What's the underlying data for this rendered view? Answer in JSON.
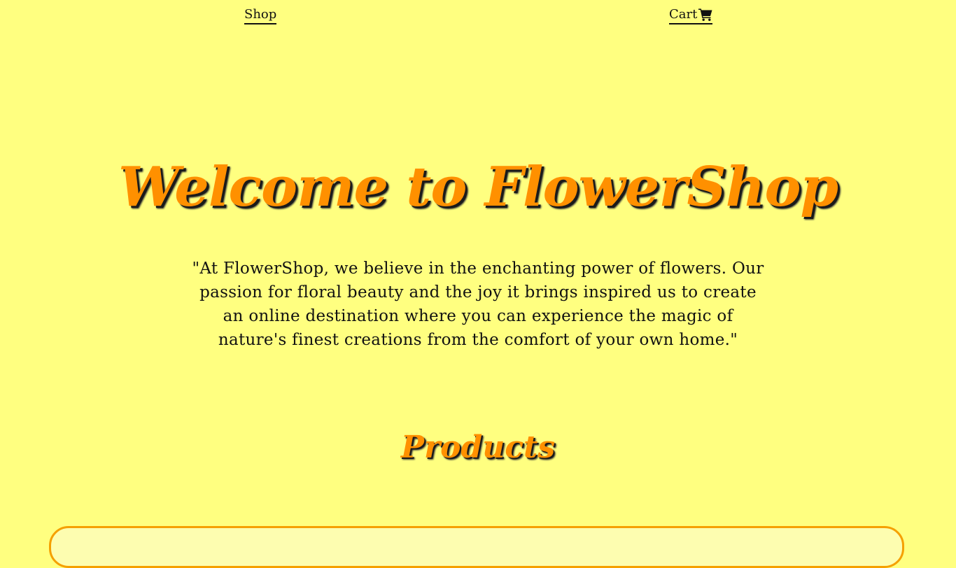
{
  "nav": {
    "shop_label": "Shop",
    "cart_label": "Cart",
    "cart_icon": "shopping-cart-icon"
  },
  "hero": {
    "title": "Welcome to FlowerShop",
    "quote": "\"At FlowerShop, we believe in the enchanting power of flowers. Our passion for floral beauty and the joy it brings inspired us to create an online destination where you can experience the magic of nature's finest creations from the comfort of your own home.\""
  },
  "products": {
    "heading": "Products"
  },
  "colors": {
    "background": "#ffff80",
    "accent": "#ff9000",
    "text": "#111111",
    "panel_border": "#f5a000"
  }
}
